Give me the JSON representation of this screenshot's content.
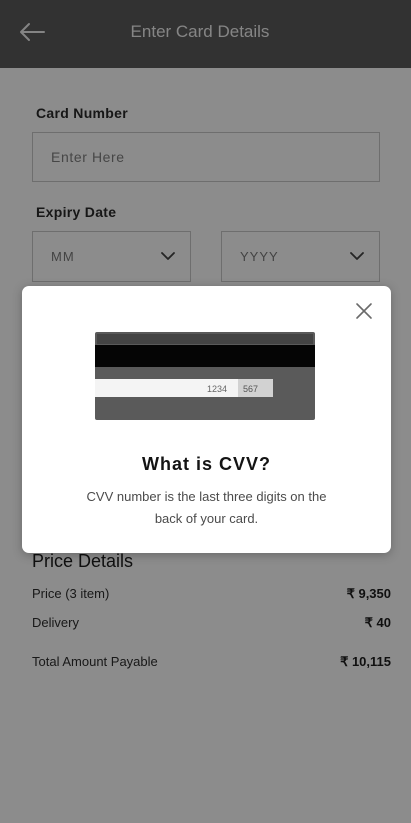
{
  "header": {
    "title": "Enter Card Details",
    "back_icon": "arrow-left-icon"
  },
  "card_number": {
    "label": "Card Number",
    "placeholder": "Enter Here"
  },
  "expiry": {
    "label": "Expiry Date",
    "month": {
      "value": "MM"
    },
    "year": {
      "value": "YYYY"
    }
  },
  "price_details": {
    "title": "Price Details",
    "rows": [
      {
        "label": "Price (3 item)",
        "value": "₹ 9,350"
      },
      {
        "label": "Delivery",
        "value": "₹ 40"
      },
      {
        "label": "Total Amount Payable",
        "value": "₹ 10,115"
      }
    ]
  },
  "cvv_modal": {
    "title": "What is CVV?",
    "description": "CVV number is the last three digits on the back of your card.",
    "card_number_digits": "1234",
    "cvv_digits": "567",
    "close_icon": "close-icon"
  }
}
